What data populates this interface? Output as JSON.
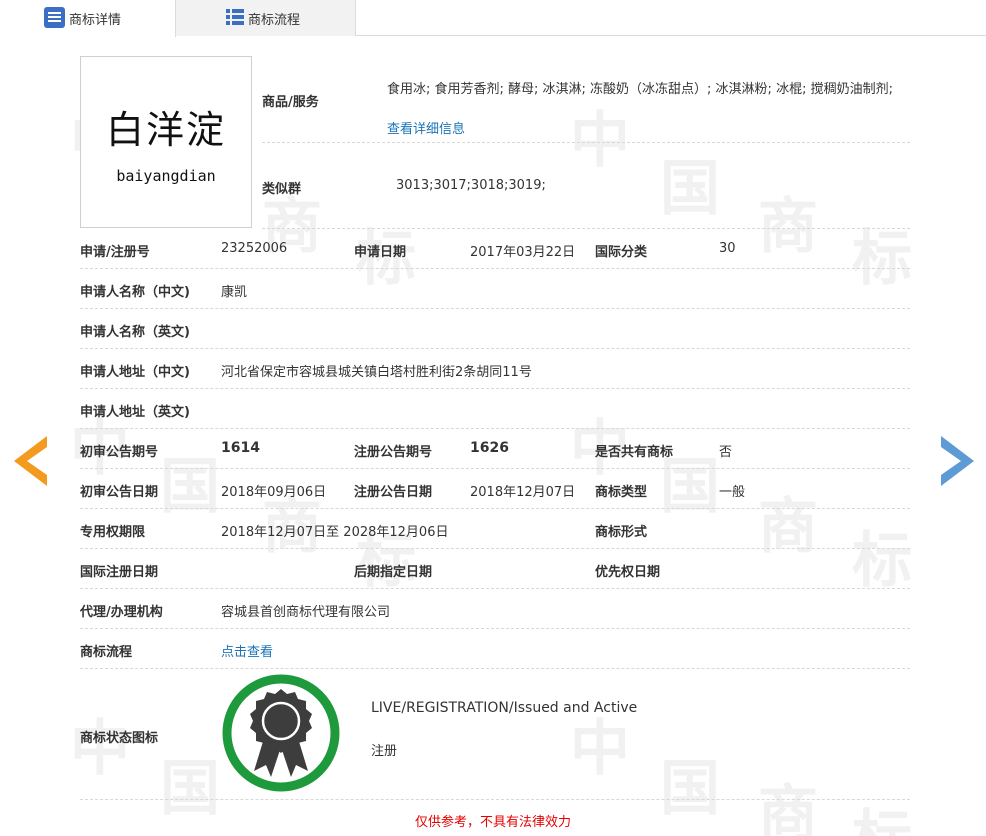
{
  "tabs": {
    "details": "商标详情",
    "flow": "商标流程"
  },
  "logo": {
    "chinese": "白洋淀",
    "pinyin": "baiyangdian"
  },
  "goods": {
    "label": "商品/服务",
    "text": "食用冰; 食用芳香剂; 酵母; 冰淇淋; 冻酸奶（冰冻甜点）; 冰淇淋粉; 冰棍; 搅稠奶油制剂;",
    "link": "查看详细信息"
  },
  "similar": {
    "label": "类似群",
    "value": "3013;3017;3018;3019;"
  },
  "fields": {
    "reg_no_label": "申请/注册号",
    "reg_no": "23252006",
    "apply_date_label": "申请日期",
    "apply_date": "2017年03月22日",
    "intl_class_label": "国际分类",
    "intl_class": "30",
    "applicant_cn_label": "申请人名称（中文)",
    "applicant_cn": "康凯",
    "applicant_en_label": "申请人名称（英文)",
    "address_cn_label": "申请人地址（中文)",
    "address_cn": "河北省保定市容城县城关镇白塔村胜利街2条胡同11号",
    "address_en_label": "申请人地址（英文)",
    "prelim_no_label": "初审公告期号",
    "prelim_no": "1614",
    "reg_pub_no_label": "注册公告期号",
    "reg_pub_no": "1626",
    "shared_label": "是否共有商标",
    "shared": "否",
    "prelim_date_label": "初审公告日期",
    "prelim_date": "2018年09月06日",
    "reg_pub_date_label": "注册公告日期",
    "reg_pub_date": "2018年12月07日",
    "tm_type_label": "商标类型",
    "tm_type": "一般",
    "exclusive_label": "专用权期限",
    "exclusive": "2018年12月07日至 2028年12月06日",
    "tm_form_label": "商标形式",
    "intl_reg_date_label": "国际注册日期",
    "later_date_label": "后期指定日期",
    "priority_date_label": "优先权日期",
    "agent_label": "代理/办理机构",
    "agent": "容城县首创商标代理有限公司",
    "flow_label": "商标流程",
    "flow_link": "点击查看",
    "status_icon_label": "商标状态图标",
    "status_en": "LIVE/REGISTRATION/Issued and Active",
    "status_cn": "注册"
  },
  "watermark": {
    "zhong": "中",
    "guo": "国",
    "shang": "商",
    "biao": "标"
  },
  "disclaimer": "仅供参考，不具有法律效力",
  "colors": {
    "tab_icon": "#3b6fc4",
    "link": "#1a73b8",
    "arrow_left": "#f49a1f",
    "arrow_right": "#5d9bd4",
    "badge_ring": "#1e9a3c",
    "badge_medal": "#3d3d3d",
    "disclaimer": "#e60000"
  },
  "icons": {
    "tab_details": "list-document-icon",
    "tab_flow": "list-icon",
    "prev": "arrow-left-icon",
    "next": "arrow-right-icon",
    "status": "award-ribbon-icon"
  }
}
